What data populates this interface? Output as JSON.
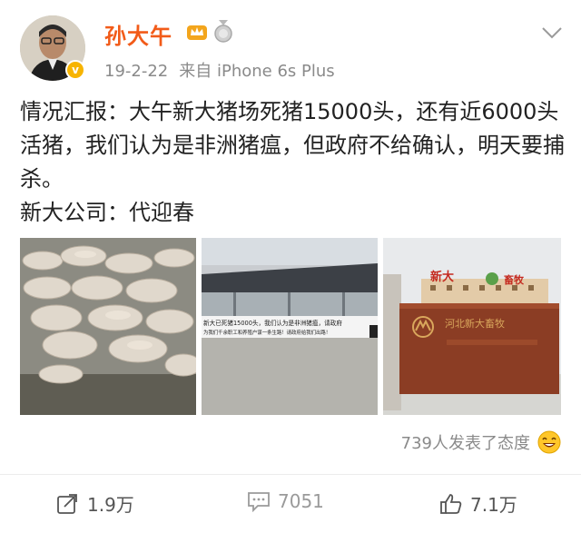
{
  "post": {
    "author": "孙大午",
    "date": "19-2-22",
    "source": "来自 iPhone 6s Plus",
    "lines": [
      "情况汇报：大午新大猪场死猪15000头，还有近6000头活猪，我们认为是非洲猪瘟，但政府不给确认，明天要捕杀。",
      "新大公司：代迎春"
    ],
    "images": [
      {
        "icon": "dead-pigs-photo"
      },
      {
        "icon": "banner-photo",
        "banner_text_1": "新大已死猪15000头，我们认为是非洲猪瘟，请政府",
        "banner_text_2": "为我们千余职工和养殖户谋一条生路！请政府给我们出路！"
      },
      {
        "icon": "company-gate-photo",
        "roof_sign_1": "新大",
        "roof_sign_2": "畜牧",
        "wall_sign": "河北新大畜牧"
      }
    ],
    "reactions": "739人发表了态度"
  },
  "actions": {
    "repost": "1.9万",
    "comment": "7051",
    "like": "7.1万"
  },
  "colors": {
    "author": "#f25b19",
    "meta": "#8a8a8a",
    "verified": "#f7b400"
  }
}
